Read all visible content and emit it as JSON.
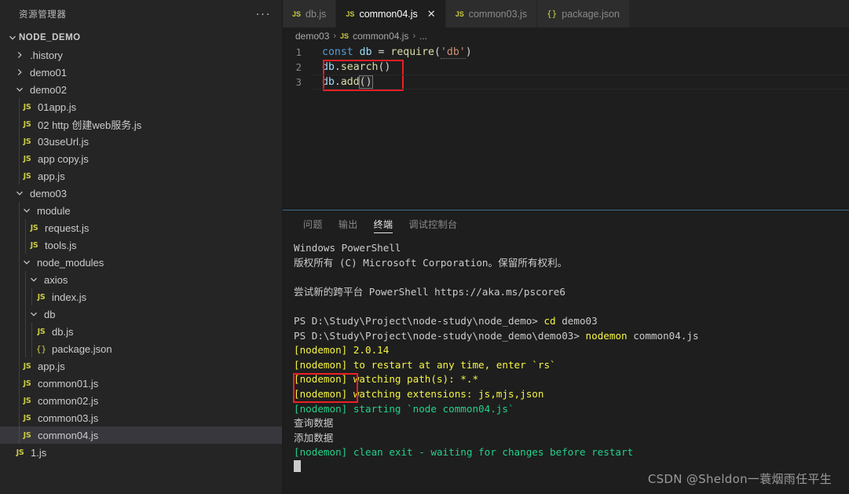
{
  "sidebar": {
    "title": "资源管理器",
    "more_label": "···",
    "root": {
      "label": "NODE_DEMO",
      "expanded": true
    },
    "items": [
      {
        "label": ".history",
        "type": "folder",
        "depth": 1,
        "expanded": false
      },
      {
        "label": "demo01",
        "type": "folder",
        "depth": 1,
        "expanded": false
      },
      {
        "label": "demo02",
        "type": "folder",
        "depth": 1,
        "expanded": true
      },
      {
        "label": "01app.js",
        "type": "js",
        "depth": 2
      },
      {
        "label": "02 http 创建web服务.js",
        "type": "js",
        "depth": 2
      },
      {
        "label": "03useUrl.js",
        "type": "js",
        "depth": 2
      },
      {
        "label": "app copy.js",
        "type": "js",
        "depth": 2
      },
      {
        "label": "app.js",
        "type": "js",
        "depth": 2
      },
      {
        "label": "demo03",
        "type": "folder",
        "depth": 1,
        "expanded": true
      },
      {
        "label": "module",
        "type": "folder",
        "depth": 2,
        "expanded": true
      },
      {
        "label": "request.js",
        "type": "js",
        "depth": 3
      },
      {
        "label": "tools.js",
        "type": "js",
        "depth": 3
      },
      {
        "label": "node_modules",
        "type": "folder",
        "depth": 2,
        "expanded": true
      },
      {
        "label": "axios",
        "type": "folder",
        "depth": 3,
        "expanded": true
      },
      {
        "label": "index.js",
        "type": "js",
        "depth": 4
      },
      {
        "label": "db",
        "type": "folder",
        "depth": 3,
        "expanded": true
      },
      {
        "label": "db.js",
        "type": "js",
        "depth": 4
      },
      {
        "label": "package.json",
        "type": "json",
        "depth": 4
      },
      {
        "label": "app.js",
        "type": "js",
        "depth": 2
      },
      {
        "label": "common01.js",
        "type": "js",
        "depth": 2
      },
      {
        "label": "common02.js",
        "type": "js",
        "depth": 2
      },
      {
        "label": "common03.js",
        "type": "js",
        "depth": 2
      },
      {
        "label": "common04.js",
        "type": "js",
        "depth": 2,
        "selected": true
      },
      {
        "label": "1.js",
        "type": "js",
        "depth": 1
      }
    ]
  },
  "tabs": [
    {
      "label": "db.js",
      "icon": "js",
      "active": false,
      "close": false
    },
    {
      "label": "common04.js",
      "icon": "js",
      "active": true,
      "close": true,
      "close_label": "✕"
    },
    {
      "label": "common03.js",
      "icon": "js",
      "active": false,
      "close": false
    },
    {
      "label": "package.json",
      "icon": "json",
      "active": false,
      "close": false
    }
  ],
  "breadcrumb": {
    "folder": "demo03",
    "sep1": "›",
    "file": "common04.js",
    "sep2": "›",
    "tail": "..."
  },
  "editor": {
    "lines": [
      {
        "number": "1",
        "tokens": [
          {
            "t": "const",
            "c": "kw"
          },
          {
            "t": " ",
            "c": "plain"
          },
          {
            "t": "db",
            "c": "var"
          },
          {
            "t": " ",
            "c": "plain"
          },
          {
            "t": "=",
            "c": "op"
          },
          {
            "t": " ",
            "c": "plain"
          },
          {
            "t": "require",
            "c": "fn"
          },
          {
            "t": "(",
            "c": "pn"
          },
          {
            "t": "'db'",
            "c": "str"
          },
          {
            "t": ")",
            "c": "pn"
          }
        ]
      },
      {
        "number": "2",
        "tokens": [
          {
            "t": "db",
            "c": "var"
          },
          {
            "t": ".",
            "c": "plain"
          },
          {
            "t": "search",
            "c": "fn"
          },
          {
            "t": "()",
            "c": "pn"
          }
        ]
      },
      {
        "number": "3",
        "tokens": [
          {
            "t": "db",
            "c": "var"
          },
          {
            "t": ".",
            "c": "plain"
          },
          {
            "t": "add",
            "c": "fn"
          },
          {
            "t": "()",
            "c": "pn"
          }
        ]
      }
    ]
  },
  "panel": {
    "tabs": [
      {
        "label": "问题",
        "active": false
      },
      {
        "label": "输出",
        "active": false
      },
      {
        "label": "终端",
        "active": true
      },
      {
        "label": "调试控制台",
        "active": false
      }
    ],
    "terminal_lines": [
      {
        "text": "Windows PowerShell",
        "color": "t-white"
      },
      {
        "text": "版权所有 (C) Microsoft Corporation。保留所有权利。",
        "color": "t-white"
      },
      {
        "text": "",
        "color": "t-gap"
      },
      {
        "text": "尝试新的跨平台 PowerShell https://aka.ms/pscore6",
        "color": "t-white"
      },
      {
        "text": "",
        "color": "t-gap"
      },
      {
        "text": "PS D:\\Study\\Project\\node-study\\node_demo> cd demo03",
        "color": "t-white",
        "cmd": "cd"
      },
      {
        "text": "PS D:\\Study\\Project\\node-study\\node_demo\\demo03> nodemon common04.js",
        "color": "t-white",
        "cmd": "nodemon"
      },
      {
        "text": "[nodemon] 2.0.14",
        "color": "t-yellow"
      },
      {
        "text": "[nodemon] to restart at any time, enter `rs`",
        "color": "t-yellow"
      },
      {
        "text": "[nodemon] watching path(s): *.*",
        "color": "t-yellow"
      },
      {
        "text": "[nodemon] watching extensions: js,mjs,json",
        "color": "t-yellow"
      },
      {
        "text": "[nodemon] starting `node common04.js`",
        "color": "t-green"
      },
      {
        "text": "查询数据",
        "color": "t-white"
      },
      {
        "text": "添加数据",
        "color": "t-white"
      },
      {
        "text": "[nodemon] clean exit - waiting for changes before restart",
        "color": "t-green"
      }
    ],
    "cursor": true
  },
  "watermark": "CSDN @Sheldon一蓑烟雨任平生",
  "annotations": {
    "editor_box": {
      "label": "code-highlight-box"
    },
    "terminal_box": {
      "label": "output-highlight-box"
    }
  },
  "colors": {
    "accent_red": "#ec2024",
    "sidebar_bg": "#252526",
    "editor_bg": "#1e1e1e",
    "js_icon": "#cbcb41",
    "terminal_yellow": "#f5f543",
    "terminal_green": "#23d18b"
  }
}
